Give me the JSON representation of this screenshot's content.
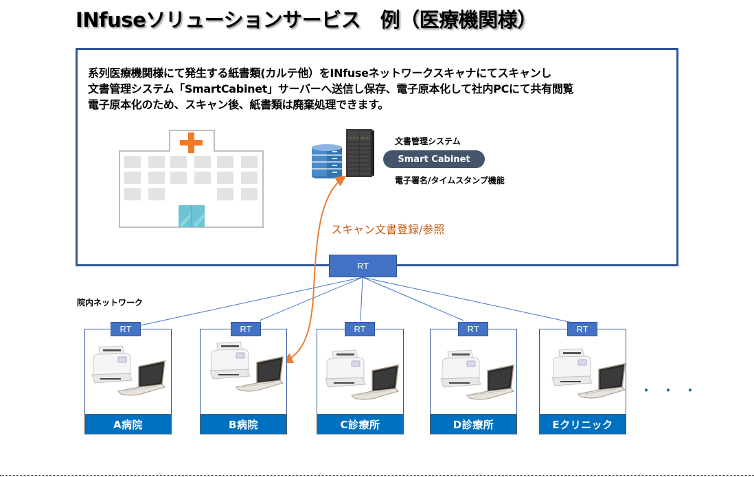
{
  "title": "INfuseソリューションサービス　例（医療機関様）",
  "description": {
    "line1": "系列医療機関様にて発生する紙書類(カルテ他）をINfuseネットワークスキャナにてスキャンし",
    "line2": "文書管理システム「SmartCabinet」サーバーへ送信し保存、電子原本化して社内PCにて共有閲覧",
    "line3": "電子原本化のため、スキャン後、紙書類は廃棄処理できます。"
  },
  "server": {
    "system_label": "文書管理システム",
    "product_name": "Smart Cabinet",
    "feature_label": "電子署名/タイムスタンプ機能"
  },
  "flow_label": "スキャン文書登録/参照",
  "main_router": {
    "label": "RT"
  },
  "network_label": "院内ネットワーク",
  "sites": [
    {
      "name": "A病院",
      "router": "RT"
    },
    {
      "name": "B病院",
      "router": "RT"
    },
    {
      "name": "C診療所",
      "router": "RT"
    },
    {
      "name": "D診療所",
      "router": "RT"
    },
    {
      "name": "Eクリニック",
      "router": "RT"
    }
  ],
  "more_indicator": "・・・",
  "colors": {
    "frame": "#2f5597",
    "router": "#4472c4",
    "site_label": "#0070c0",
    "flow_arrow": "#ed7d31",
    "flow_text": "#c55a11",
    "pill": "#44546a",
    "hospital_cross": "#f07a2a"
  }
}
